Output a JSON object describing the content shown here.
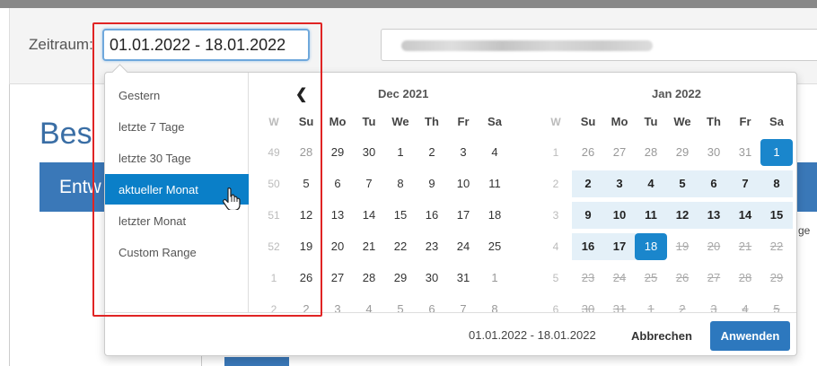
{
  "filter": {
    "label": "Zeitraum:",
    "date_value": "01.01.2022 - 18.01.2022"
  },
  "page": {
    "heading": "Bes",
    "tab_label": "Entw",
    "peek": "ge"
  },
  "ranges": [
    {
      "label": "Gestern"
    },
    {
      "label": "letzte 7 Tage"
    },
    {
      "label": "letzte 30 Tage"
    },
    {
      "label": "aktueller Monat",
      "active": true
    },
    {
      "label": "letzter Monat"
    },
    {
      "label": "Custom Range"
    }
  ],
  "weekday_headers": [
    "W",
    "Su",
    "Mo",
    "Tu",
    "We",
    "Th",
    "Fr",
    "Sa"
  ],
  "left_calendar": {
    "month": "Dec 2021",
    "prev_icon": "chevron-left-icon",
    "rows": [
      [
        "49",
        "28",
        "29",
        "30",
        "1",
        "2",
        "3",
        "4"
      ],
      [
        "50",
        "5",
        "6",
        "7",
        "8",
        "9",
        "10",
        "11"
      ],
      [
        "51",
        "12",
        "13",
        "14",
        "15",
        "16",
        "17",
        "18"
      ],
      [
        "52",
        "19",
        "20",
        "21",
        "22",
        "23",
        "24",
        "25"
      ],
      [
        "1",
        "26",
        "27",
        "28",
        "29",
        "30",
        "31",
        "1"
      ],
      [
        "2",
        "2",
        "3",
        "4",
        "5",
        "6",
        "7",
        "8"
      ]
    ]
  },
  "right_calendar": {
    "month": "Jan 2022",
    "rows": [
      [
        "1",
        "26",
        "27",
        "28",
        "29",
        "30",
        "31",
        "1"
      ],
      [
        "2",
        "2",
        "3",
        "4",
        "5",
        "6",
        "7",
        "8"
      ],
      [
        "3",
        "9",
        "10",
        "11",
        "12",
        "13",
        "14",
        "15"
      ],
      [
        "4",
        "16",
        "17",
        "18",
        "19",
        "20",
        "21",
        "22"
      ],
      [
        "5",
        "23",
        "24",
        "25",
        "26",
        "27",
        "28",
        "29"
      ],
      [
        "6",
        "30",
        "31",
        "1",
        "2",
        "3",
        "4",
        "5"
      ]
    ]
  },
  "footer": {
    "range_text": "01.01.2022 - 18.01.2022",
    "cancel_label": "Abbrechen",
    "apply_label": "Anwenden"
  },
  "colors": {
    "accent": "#1a86cc",
    "apply_button": "#2d78be",
    "active_range": "#0a7fc8",
    "annotation_frame": "#e02424"
  }
}
